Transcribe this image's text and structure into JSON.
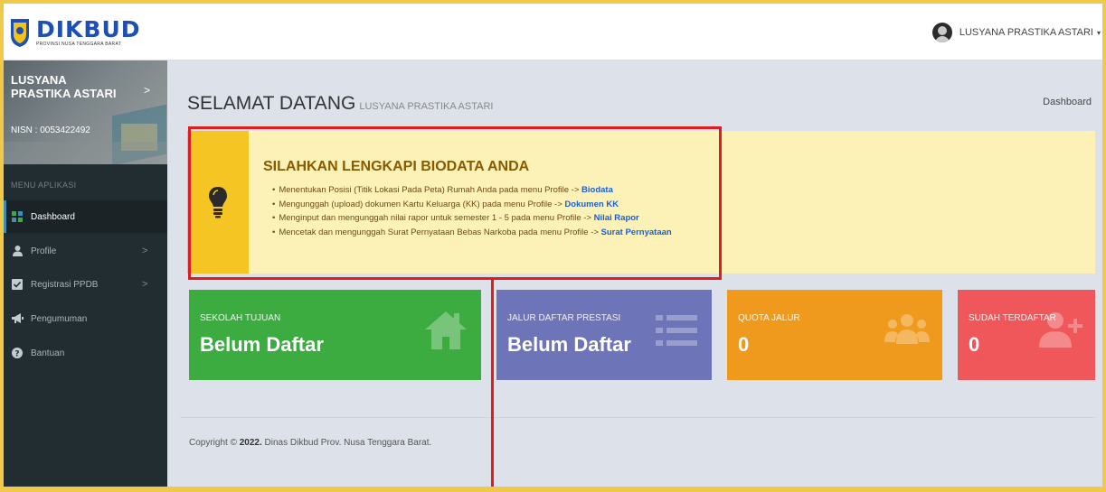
{
  "brand": {
    "name": "DIKBUD",
    "subtitle": "PROVINSI NUSA TENGGARA BARAT"
  },
  "user_menu": {
    "name": "LUSYANA PRASTIKA ASTARI",
    "caret": "▾"
  },
  "sidebar": {
    "user_name": "LUSYANA PRASTIKA ASTARI",
    "nisn": "NISN : 0053422492",
    "menu_header": "MENU APLIKASI",
    "items": [
      {
        "label": "Dashboard",
        "icon": "dashboard-icon",
        "active": true
      },
      {
        "label": "Profile",
        "icon": "user-icon",
        "chevron": ">"
      },
      {
        "label": "Registrasi PPDB",
        "icon": "checkbox-icon",
        "chevron": ">"
      },
      {
        "label": "Pengumuman",
        "icon": "bullhorn-icon"
      },
      {
        "label": "Bantuan",
        "icon": "question-icon"
      }
    ],
    "panel_chevron": ">"
  },
  "header": {
    "title": "SELAMAT DATANG",
    "subtitle": "LUSYANA PRASTIKA ASTARI",
    "breadcrumb": "Dashboard"
  },
  "callout": {
    "title": "SILAHKAN LENGKAPI BIODATA ANDA",
    "items": [
      {
        "text": "Menentukan Posisi (Titik Lokasi Pada Peta) Rumah Anda pada menu Profile -> ",
        "link": "Biodata"
      },
      {
        "text": "Mengunggah (upload) dokumen Kartu Keluarga (KK) pada menu Profile -> ",
        "link": "Dokumen KK"
      },
      {
        "text": "Menginput dan mengunggah nilai rapor untuk semester 1 - 5 pada menu Profile -> ",
        "link": "Nilai Rapor"
      },
      {
        "text": "Mencetak dan mengunggah Surat Pernyataan Bebas Narkoba pada menu Profile -> ",
        "link": "Surat Pernyataan"
      }
    ],
    "icon": "lightbulb-icon"
  },
  "stat_boxes": [
    {
      "label": "SEKOLAH TUJUAN",
      "value": "Belum Daftar",
      "color": "#3cab40",
      "icon": "home-icon"
    },
    {
      "label": "JALUR DAFTAR PRESTASI",
      "value": "Belum Daftar",
      "color": "#6e74b8",
      "icon": "list-icon"
    },
    {
      "label": "QUOTA JALUR",
      "value": "0",
      "color": "#f09a1d",
      "icon": "users-icon"
    },
    {
      "label": "SUDAH TERDAFTAR",
      "value": "0",
      "color": "#f0575a",
      "icon": "user-plus-icon"
    }
  ],
  "footer": {
    "prefix": "Copyright © ",
    "year": "2022.",
    "suffix": " Dinas Dikbud Prov. Nusa Tenggara Barat."
  },
  "colors": {
    "sidebar_bg": "#222d32",
    "content_bg": "#dde2ea",
    "callout_bg": "#fcf2b8",
    "callout_icon_bg": "#f5c623",
    "annotation_red": "#e01d1d",
    "link_blue": "#1a5fd6"
  }
}
